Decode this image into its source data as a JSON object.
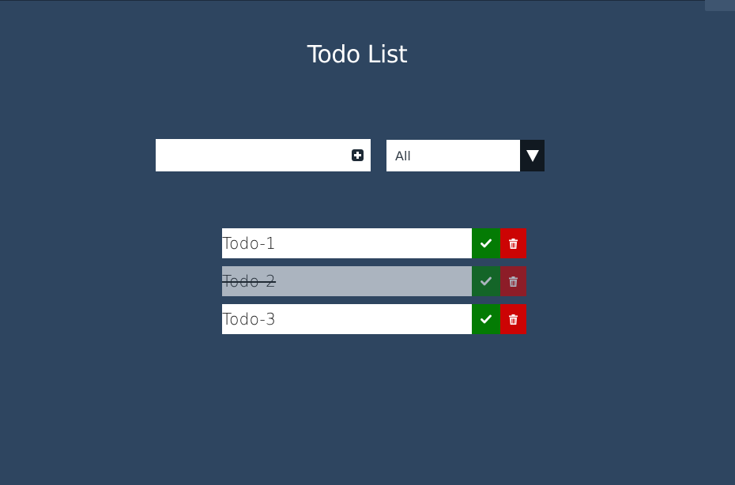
{
  "app": {
    "title": "Todo List"
  },
  "form": {
    "input_value": "",
    "input_placeholder": "",
    "add_icon": "plus-square-icon"
  },
  "filter": {
    "selected": "All",
    "arrow_icon": "caret-down-icon"
  },
  "todos": [
    {
      "text": "Todo-1",
      "completed": false
    },
    {
      "text": "Todo-2",
      "completed": true
    },
    {
      "text": "Todo-3",
      "completed": false
    }
  ],
  "colors": {
    "background": "#2e4560",
    "complete": "#047b04",
    "delete": "#cc0404",
    "select_arrow_bg": "#111921"
  }
}
